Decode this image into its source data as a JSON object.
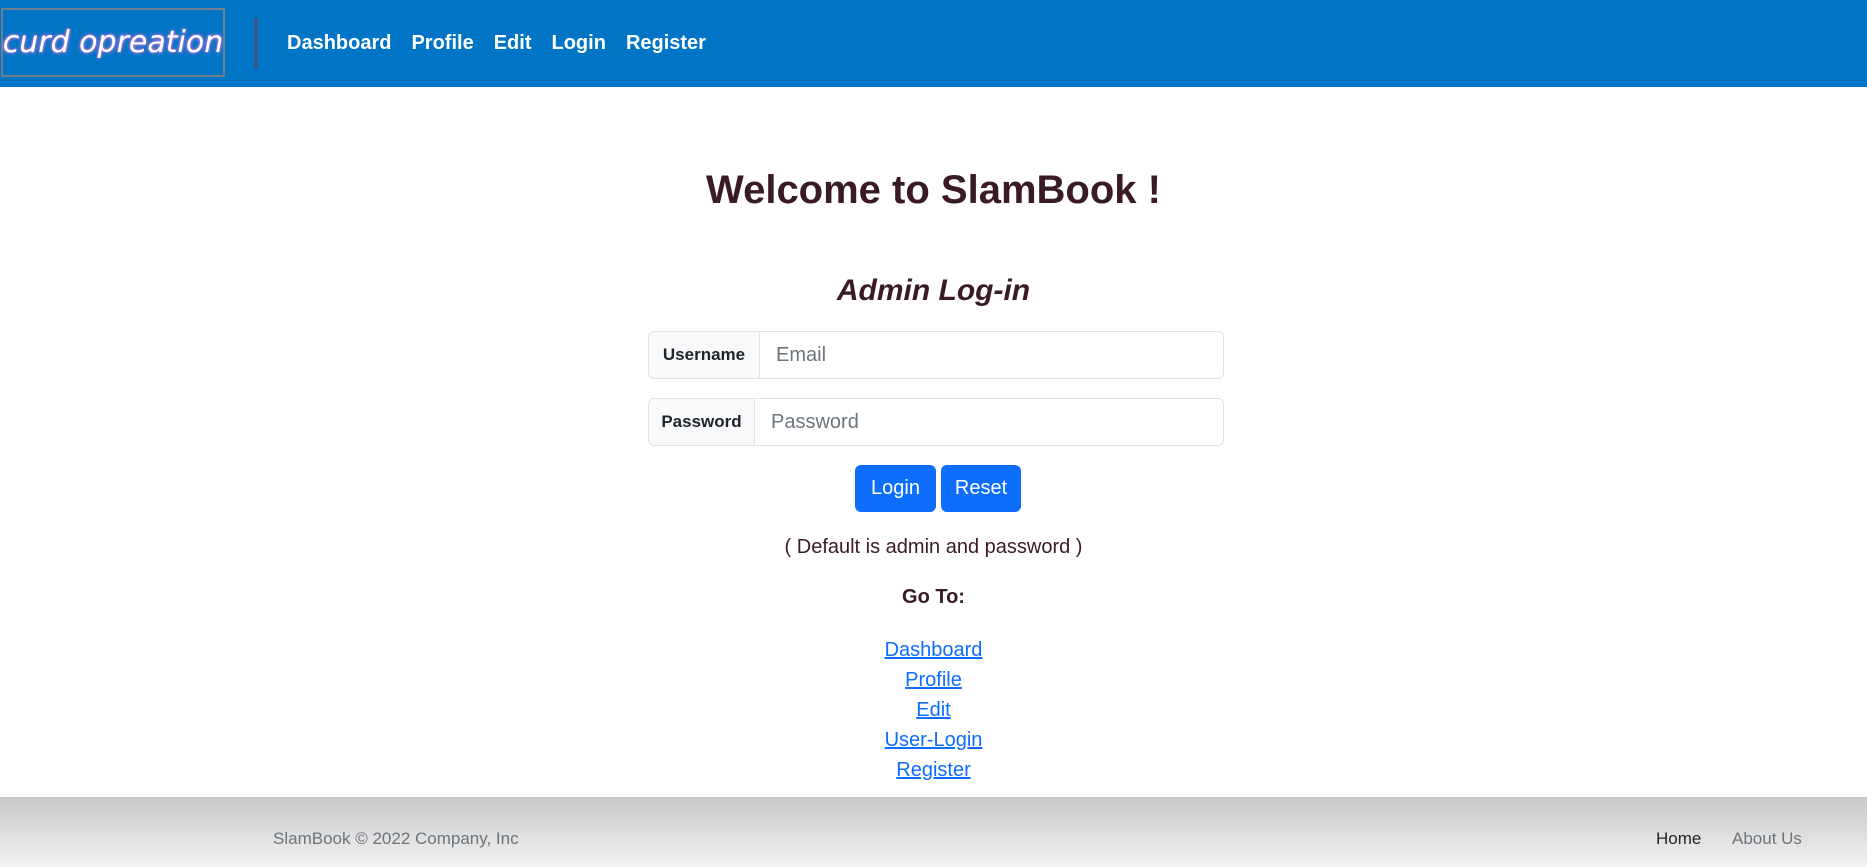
{
  "navbar": {
    "brand": "curd opreation",
    "links": [
      "Dashboard",
      "Profile",
      "Edit",
      "Login",
      "Register"
    ]
  },
  "main": {
    "title": "Welcome to SlamBook !",
    "subtitle": "Admin Log-in",
    "username_label": "Username",
    "username_placeholder": "Email",
    "password_label": "Password",
    "password_placeholder": "Password",
    "login_button": "Login",
    "reset_button": "Reset",
    "default_note": "( Default is admin and password )",
    "goto_label": "Go To:",
    "goto_links": [
      "Dashboard",
      "Profile",
      "Edit",
      "User-Login",
      "Register"
    ]
  },
  "footer": {
    "copyright": "SlamBook © 2022 Company, Inc",
    "home_link": "Home",
    "about_link": "About Us"
  },
  "colors": {
    "navbar_bg": "#0075c5",
    "primary_button": "#0d6efd",
    "heading_text": "#3a1a24",
    "link": "#0d6efd"
  }
}
